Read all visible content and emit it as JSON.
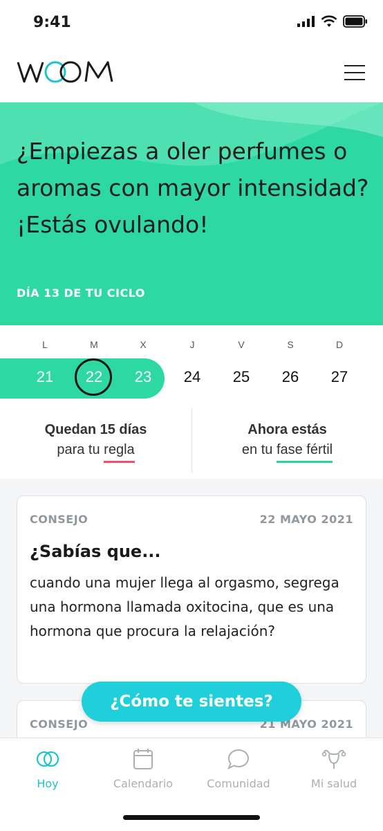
{
  "status": {
    "time": "9:41"
  },
  "header": {
    "brand": "WOOM"
  },
  "hero": {
    "message": "¿Empiezas a oler perfumes o aromas con mayor intensidad? ¡Estás ovulando!",
    "cycle_day": "DÍA 13 DE TU CICLO",
    "background": "#2dd8a2"
  },
  "week": {
    "letters": [
      "L",
      "M",
      "X",
      "J",
      "V",
      "S",
      "D"
    ],
    "days": [
      "21",
      "22",
      "23",
      "24",
      "25",
      "26",
      "27"
    ]
  },
  "info": {
    "period_bold": "Quedan 15 días",
    "period_pre": "para tu ",
    "period_link": "regla",
    "phase_bold": "Ahora estás",
    "phase_pre": "en tu ",
    "phase_link": "fase fértil"
  },
  "cards": [
    {
      "tag": "CONSEJO",
      "date": "22 MAYO 2021",
      "title": "¿Sabías que...",
      "body": "cuando una mujer llega al orgasmo, segrega una hormona llamada oxitocina, que es una hormona que procura la relajación?"
    },
    {
      "tag": "CONSEJO",
      "date": "21 MAYO 2021"
    }
  ],
  "fab": {
    "label": "¿Cómo te sientes?",
    "color": "#1fcfd9"
  },
  "tabbar": {
    "items": [
      {
        "label": "Hoy",
        "icon": "rings-icon"
      },
      {
        "label": "Calendario",
        "icon": "calendar-icon"
      },
      {
        "label": "Comunidad",
        "icon": "chat-bubble-icon"
      },
      {
        "label": "Mi salud",
        "icon": "uterus-icon"
      }
    ]
  }
}
